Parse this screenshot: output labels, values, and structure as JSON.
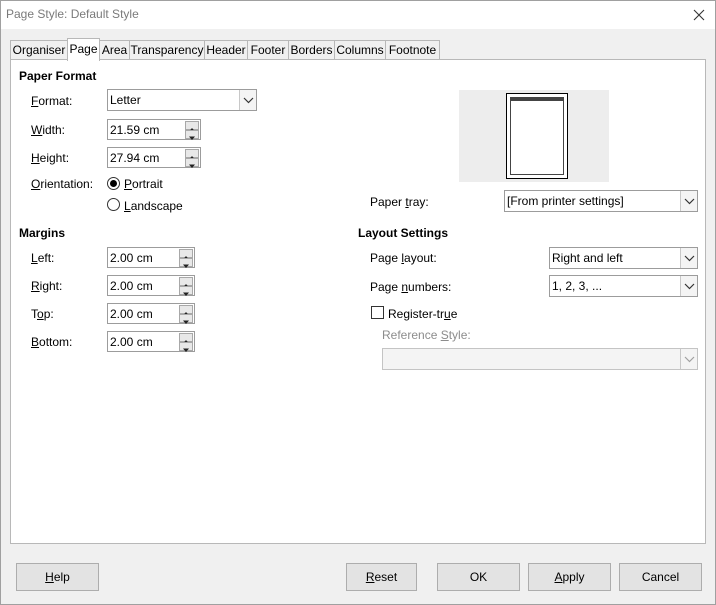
{
  "window": {
    "title": "Page Style: Default Style"
  },
  "tabs": [
    {
      "label": "Organiser"
    },
    {
      "label": "Page"
    },
    {
      "label": "Area"
    },
    {
      "label": "Transparency"
    },
    {
      "label": "Header"
    },
    {
      "label": "Footer"
    },
    {
      "label": "Borders"
    },
    {
      "label": "Columns"
    },
    {
      "label": "Footnote"
    }
  ],
  "paper_format": {
    "heading": "Paper Format",
    "format_label_key": "F",
    "format_label_rest": "ormat:",
    "format_value": "Letter",
    "width_label_key": "W",
    "width_label_rest": "idth:",
    "width_value": "21.59 cm",
    "height_label_key": "H",
    "height_label_rest": "eight:",
    "height_value": "27.94 cm",
    "orientation_label_key": "O",
    "orientation_label_rest": "rientation:",
    "portrait_key": "P",
    "portrait_rest": "ortrait",
    "landscape_key": "L",
    "landscape_rest": "andscape",
    "orientation_selected": "Portrait"
  },
  "paper_tray": {
    "label_pre": "Paper ",
    "label_key": "t",
    "label_post": "ray:",
    "value": "[From printer settings]"
  },
  "margins": {
    "heading": "Margins",
    "left_key": "L",
    "left_rest": "eft:",
    "left_value": "2.00 cm",
    "right_key": "R",
    "right_rest": "ight:",
    "right_value": "2.00 cm",
    "top_pre": "T",
    "top_key": "o",
    "top_rest": "p:",
    "top_value": "2.00 cm",
    "bottom_key": "B",
    "bottom_rest": "ottom:",
    "bottom_value": "2.00 cm"
  },
  "layout_settings": {
    "heading": "Layout Settings",
    "page_layout_pre": "Page ",
    "page_layout_key": "l",
    "page_layout_post": "ayout:",
    "page_layout_value": "Right and left",
    "page_numbers_pre": "Page ",
    "page_numbers_key": "n",
    "page_numbers_post": "umbers:",
    "page_numbers_value": "1, 2, 3, ...",
    "register_true_pre": "Register-tr",
    "register_true_key": "u",
    "register_true_post": "e",
    "reference_style_pre": "Reference ",
    "reference_style_key": "S",
    "reference_style_post": "tyle:",
    "reference_style_value": ""
  },
  "buttons": {
    "help_key": "H",
    "help_rest": "elp",
    "reset_key": "R",
    "reset_rest": "eset",
    "ok": "OK",
    "apply_key": "A",
    "apply_rest": "pply",
    "cancel": "Cancel"
  }
}
